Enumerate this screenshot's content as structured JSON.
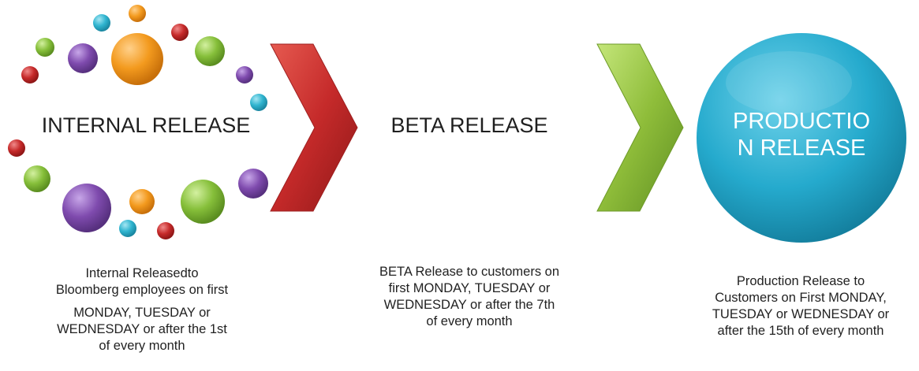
{
  "stages": {
    "internal": {
      "title": "INTERNAL RELEASE",
      "caption_line1": "Internal Releasedto",
      "caption_line2": "Bloomberg employees on first",
      "caption_line3": "MONDAY, TUESDAY or",
      "caption_line4": "WEDNESDAY or after the 1st",
      "caption_line5": "of every month"
    },
    "beta": {
      "title": "BETA RELEASE",
      "caption_line1": "BETA Release to customers on",
      "caption_line2": "first MONDAY, TUESDAY or",
      "caption_line3": "WEDNESDAY or after the 7th",
      "caption_line4": "of every month"
    },
    "production": {
      "title_line1": "PRODUCTIO",
      "title_line2": "N RELEASE",
      "caption_line1": "Production Release to",
      "caption_line2": "Customers on First MONDAY,",
      "caption_line3": "TUESDAY or WEDNESDAY or",
      "caption_line4": "after the 15th of every month"
    }
  },
  "colors": {
    "orange": "#f39a1e",
    "teal": "#2fb4cf",
    "red": "#c62a2a",
    "purple": "#7f4bae",
    "green": "#86bf3a",
    "arrow_red": "#c52a2a",
    "arrow_green": "#8fbd3a",
    "production_circle": "#1fa6c9"
  }
}
